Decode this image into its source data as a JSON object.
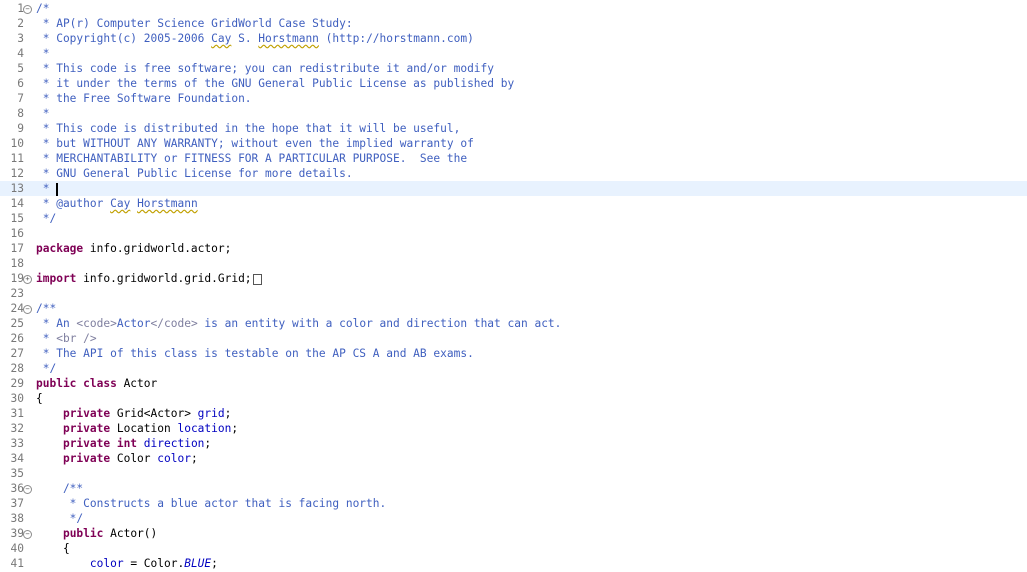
{
  "editor": {
    "lines": [
      {
        "n": "1",
        "fold": "−",
        "segs": [
          {
            "t": "/*",
            "k": "c"
          }
        ]
      },
      {
        "n": "2",
        "segs": [
          {
            "t": " * AP(r) Computer Science GridWorld Case Study:",
            "k": "c"
          }
        ]
      },
      {
        "n": "3",
        "segs": [
          {
            "t": " * Copyright(c) 2005-2006 ",
            "k": "c"
          },
          {
            "t": "Cay",
            "k": "c sq"
          },
          {
            "t": " S. ",
            "k": "c"
          },
          {
            "t": "Horstmann",
            "k": "c sq"
          },
          {
            "t": " (http://horstmann.com)",
            "k": "c"
          }
        ]
      },
      {
        "n": "4",
        "segs": [
          {
            "t": " *",
            "k": "c"
          }
        ]
      },
      {
        "n": "5",
        "segs": [
          {
            "t": " * This code is free software; you can redistribute it and/or modify",
            "k": "c"
          }
        ]
      },
      {
        "n": "6",
        "segs": [
          {
            "t": " * it under the terms of the GNU General Public License as published by",
            "k": "c"
          }
        ]
      },
      {
        "n": "7",
        "segs": [
          {
            "t": " * the Free Software Foundation.",
            "k": "c"
          }
        ]
      },
      {
        "n": "8",
        "segs": [
          {
            "t": " *",
            "k": "c"
          }
        ]
      },
      {
        "n": "9",
        "segs": [
          {
            "t": " * This code is distributed in the hope that it will be useful,",
            "k": "c"
          }
        ]
      },
      {
        "n": "10",
        "segs": [
          {
            "t": " * but WITHOUT ANY WARRANTY; without even the implied warranty of",
            "k": "c"
          }
        ]
      },
      {
        "n": "11",
        "segs": [
          {
            "t": " * MERCHANTABILITY or FITNESS FOR A PARTICULAR PURPOSE.  See the",
            "k": "c"
          }
        ]
      },
      {
        "n": "12",
        "segs": [
          {
            "t": " * GNU General Public License for more details.",
            "k": "c"
          }
        ]
      },
      {
        "n": "13",
        "current": true,
        "caret": true,
        "segs": [
          {
            "t": " * ",
            "k": "c"
          }
        ]
      },
      {
        "n": "14",
        "segs": [
          {
            "t": " * @author ",
            "k": "c"
          },
          {
            "t": "Cay",
            "k": "c sq"
          },
          {
            "t": " ",
            "k": "c"
          },
          {
            "t": "Horstmann",
            "k": "c sq"
          }
        ]
      },
      {
        "n": "15",
        "segs": [
          {
            "t": " */",
            "k": "c"
          }
        ]
      },
      {
        "n": "16",
        "segs": []
      },
      {
        "n": "17",
        "segs": [
          {
            "t": "package",
            "k": "kw"
          },
          {
            "t": " info.gridworld.actor;",
            "k": ""
          }
        ]
      },
      {
        "n": "18",
        "segs": []
      },
      {
        "n": "19",
        "fold": "+",
        "box": true,
        "segs": [
          {
            "t": "import",
            "k": "kw"
          },
          {
            "t": " info.gridworld.grid.Grid;",
            "k": ""
          }
        ]
      },
      {
        "n": "23",
        "segs": []
      },
      {
        "n": "24",
        "fold": "−",
        "segs": [
          {
            "t": "/**",
            "k": "c"
          }
        ]
      },
      {
        "n": "25",
        "segs": [
          {
            "t": " * An ",
            "k": "c"
          },
          {
            "t": "<code>",
            "k": "tag"
          },
          {
            "t": "Actor",
            "k": "c"
          },
          {
            "t": "</code>",
            "k": "tag"
          },
          {
            "t": " is an entity with a color and direction that can act.",
            "k": "c"
          }
        ]
      },
      {
        "n": "26",
        "segs": [
          {
            "t": " * ",
            "k": "c"
          },
          {
            "t": "<br />",
            "k": "tag"
          }
        ]
      },
      {
        "n": "27",
        "segs": [
          {
            "t": " * The API of this class is testable on the AP CS A and AB exams.",
            "k": "c"
          }
        ]
      },
      {
        "n": "28",
        "segs": [
          {
            "t": " */",
            "k": "c"
          }
        ]
      },
      {
        "n": "29",
        "segs": [
          {
            "t": "public class",
            "k": "kw"
          },
          {
            "t": " Actor",
            "k": ""
          }
        ]
      },
      {
        "n": "30",
        "segs": [
          {
            "t": "{",
            "k": ""
          }
        ]
      },
      {
        "n": "31",
        "segs": [
          {
            "t": "    ",
            "k": ""
          },
          {
            "t": "private",
            "k": "kw"
          },
          {
            "t": " Grid<Actor> ",
            "k": ""
          },
          {
            "t": "grid",
            "k": "fld"
          },
          {
            "t": ";",
            "k": ""
          }
        ]
      },
      {
        "n": "32",
        "segs": [
          {
            "t": "    ",
            "k": ""
          },
          {
            "t": "private",
            "k": "kw"
          },
          {
            "t": " Location ",
            "k": ""
          },
          {
            "t": "location",
            "k": "fld"
          },
          {
            "t": ";",
            "k": ""
          }
        ]
      },
      {
        "n": "33",
        "segs": [
          {
            "t": "    ",
            "k": ""
          },
          {
            "t": "private int",
            "k": "kw"
          },
          {
            "t": " ",
            "k": ""
          },
          {
            "t": "direction",
            "k": "fld"
          },
          {
            "t": ";",
            "k": ""
          }
        ]
      },
      {
        "n": "34",
        "segs": [
          {
            "t": "    ",
            "k": ""
          },
          {
            "t": "private",
            "k": "kw"
          },
          {
            "t": " Color ",
            "k": ""
          },
          {
            "t": "color",
            "k": "fld"
          },
          {
            "t": ";",
            "k": ""
          }
        ]
      },
      {
        "n": "35",
        "segs": []
      },
      {
        "n": "36",
        "fold": "−",
        "segs": [
          {
            "t": "    /**",
            "k": "c"
          }
        ]
      },
      {
        "n": "37",
        "segs": [
          {
            "t": "     * Constructs a blue actor that is facing north.",
            "k": "c"
          }
        ]
      },
      {
        "n": "38",
        "segs": [
          {
            "t": "     */",
            "k": "c"
          }
        ]
      },
      {
        "n": "39",
        "fold": "−",
        "segs": [
          {
            "t": "    ",
            "k": ""
          },
          {
            "t": "public",
            "k": "kw"
          },
          {
            "t": " Actor()",
            "k": ""
          }
        ]
      },
      {
        "n": "40",
        "segs": [
          {
            "t": "    {",
            "k": ""
          }
        ]
      },
      {
        "n": "41",
        "segs": [
          {
            "t": "        ",
            "k": ""
          },
          {
            "t": "color",
            "k": "fld"
          },
          {
            "t": " = Color.",
            "k": ""
          },
          {
            "t": "BLUE",
            "k": "sf"
          },
          {
            "t": ";",
            "k": ""
          }
        ]
      }
    ]
  }
}
